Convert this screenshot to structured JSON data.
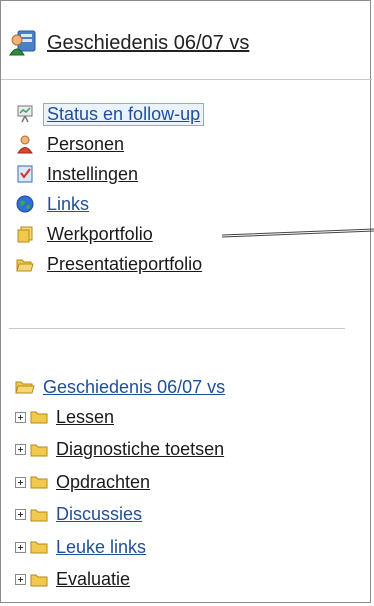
{
  "header": {
    "title": "Geschiedenis 06/07 vs",
    "icon": "course-users-icon"
  },
  "nav": [
    {
      "label": "Status en follow-up",
      "icon": "presentation-board-icon",
      "selected": true
    },
    {
      "label": "Personen",
      "icon": "person-icon"
    },
    {
      "label": "Instellingen",
      "icon": "checklist-icon"
    },
    {
      "label": "Links",
      "icon": "globe-icon"
    },
    {
      "label": "Werkportfolio",
      "icon": "folder-stack-icon"
    },
    {
      "label": "Presentatieportfolio",
      "icon": "open-folder-icon"
    }
  ],
  "course": {
    "label": "Geschiedenis 06/07 vs",
    "icon": "open-folder-icon"
  },
  "tree": [
    {
      "label": "Lessen"
    },
    {
      "label": "Diagnostiche toetsen"
    },
    {
      "label": "Opdrachten"
    },
    {
      "label": "Discussies"
    },
    {
      "label": "Leuke links"
    },
    {
      "label": "Evaluatie"
    }
  ],
  "colors": {
    "link": "#1f4e9a",
    "text": "#1a1a1a",
    "folder": "#f2c94c",
    "border": "#8c8c8c"
  }
}
